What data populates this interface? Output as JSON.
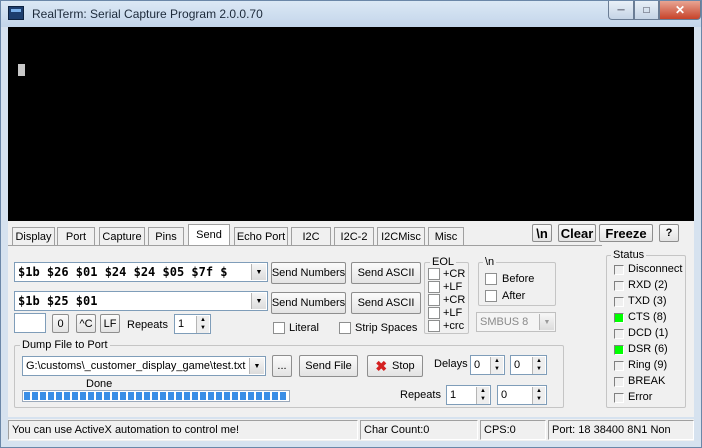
{
  "window": {
    "title": "RealTerm: Serial Capture Program 2.0.0.70",
    "min": "─",
    "max": "□",
    "close": "✕"
  },
  "tabs": [
    {
      "label": "Display"
    },
    {
      "label": "Port"
    },
    {
      "label": "Capture"
    },
    {
      "label": "Pins"
    },
    {
      "label": "Send"
    },
    {
      "label": "Echo Port"
    },
    {
      "label": "I2C"
    },
    {
      "label": "I2C-2"
    },
    {
      "label": "I2CMisc"
    },
    {
      "label": "Misc"
    }
  ],
  "active_tab": "Send",
  "toolbar": {
    "newline": "\\n",
    "clear": "Clear",
    "freeze": "Freeze",
    "help": "?"
  },
  "send": {
    "line1_value": "$1b $26 $01 $24 $24 $05 $7f $",
    "line2_value": "$1b $25 $01",
    "send_numbers": "Send Numbers",
    "send_ascii": "Send ASCII",
    "zero_btn": "0",
    "ctrl_c_btn": "^C",
    "lf_btn": "LF",
    "repeats_label": "Repeats",
    "repeats_value": "1",
    "literal_label": "Literal",
    "strip_spaces_label": "Strip Spaces"
  },
  "eol": {
    "title": "EOL",
    "items": [
      "+CR",
      "+LF",
      "+CR",
      "+LF",
      "+crc"
    ]
  },
  "newline_group": {
    "title": "\\n",
    "before": "Before",
    "after": "After"
  },
  "smbus": {
    "value": "SMBUS 8"
  },
  "dump": {
    "title": "Dump File to Port",
    "file_path": "G:\\customs\\_customer_display_game\\test.txt",
    "browse": "...",
    "send_file": "Send File",
    "stop": "Stop",
    "delays_label": "Delays",
    "delay1": "0",
    "delay2": "0",
    "progress_label": "Done",
    "progress_fraction": 1.0,
    "repeats_label": "Repeats",
    "repeats1": "1",
    "repeats2": "0"
  },
  "status": {
    "title": "Status",
    "items": [
      {
        "label": "Disconnect",
        "on": false
      },
      {
        "label": "RXD (2)",
        "on": false
      },
      {
        "label": "TXD (3)",
        "on": false
      },
      {
        "label": "CTS (8)",
        "on": true
      },
      {
        "label": "DCD (1)",
        "on": false
      },
      {
        "label": "DSR (6)",
        "on": true
      },
      {
        "label": "Ring (9)",
        "on": false
      },
      {
        "label": "BREAK",
        "on": false
      },
      {
        "label": "Error",
        "on": false
      }
    ]
  },
  "statusbar": {
    "message": "You can use ActiveX automation to control me!",
    "char_count": "Char Count:0",
    "cps": "CPS:0",
    "port": "Port: 18 38400 8N1 Non"
  },
  "colors": {
    "led_on": "#00ff00",
    "stop_icon": "#d42020",
    "progress": "#3a8ee6"
  }
}
